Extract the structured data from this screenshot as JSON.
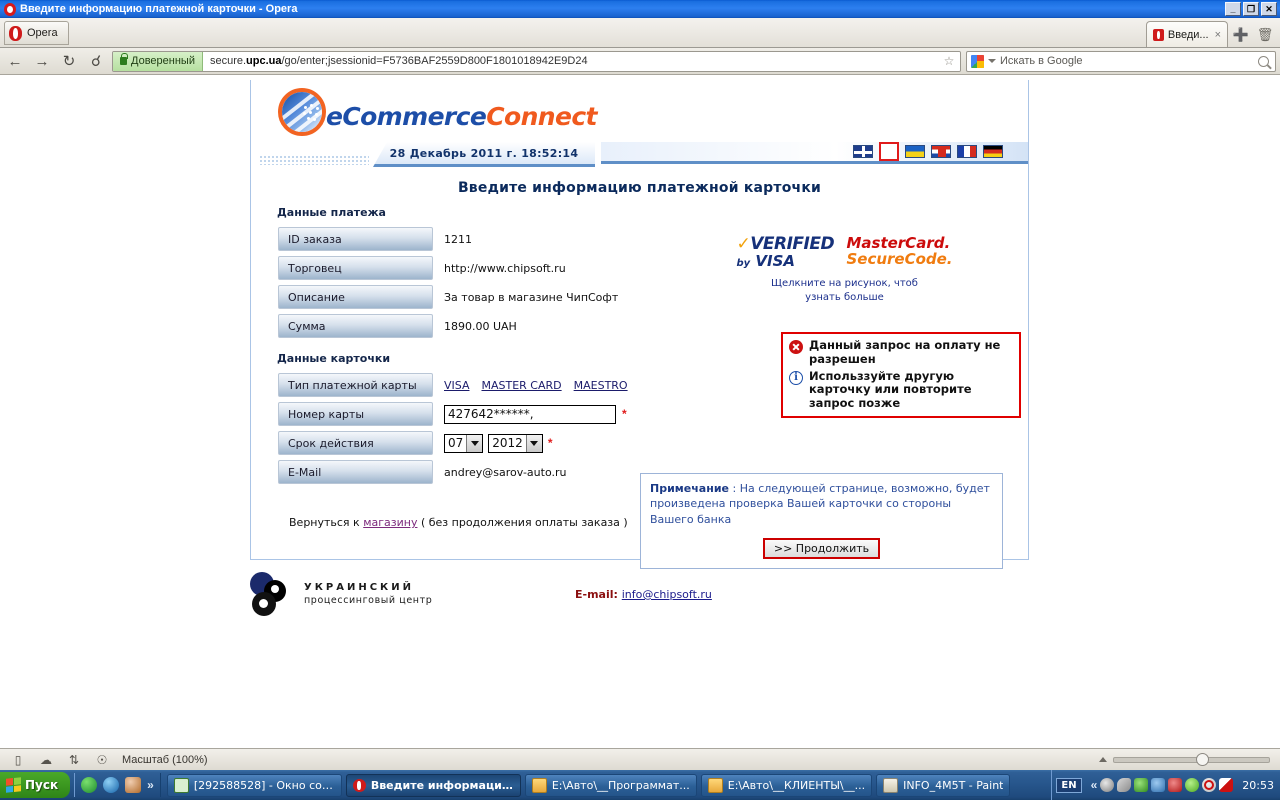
{
  "window": {
    "title": "Введите информацию платежной карточки - Opera",
    "icon": "opera-icon",
    "buttons": {
      "minimize": "_",
      "restore": "❐",
      "close": "✕"
    }
  },
  "browser": {
    "menu_button": "Opera",
    "tab": {
      "label": "Введи...",
      "close": "×"
    },
    "new_tab_icon": "plus-icon",
    "trash_icon": "trash-icon",
    "nav": {
      "back": "←",
      "forward": "→",
      "reload": "↻",
      "wand": "🔑"
    },
    "security_badge": "Доверенный",
    "url_prefix": "secure.",
    "url_host": "upc.ua",
    "url_rest": "/go/enter;jsessionid=F5736BAF2559D800F1801018942E9D24",
    "bookmark_icon": "star-icon",
    "search": {
      "engine": "google-icon",
      "placeholder": "Искать в Google"
    }
  },
  "site": {
    "logo": {
      "part1": "eCommerce",
      "part2": "Connect"
    },
    "datetime": "28 Декабрь 2011 г. 18:52:14",
    "languages": [
      {
        "name": "flag-uk",
        "selected": false
      },
      {
        "name": "flag-ru",
        "selected": true
      },
      {
        "name": "flag-ua",
        "selected": false
      },
      {
        "name": "flag-hr",
        "selected": false
      },
      {
        "name": "flag-fr",
        "selected": false
      },
      {
        "name": "flag-de",
        "selected": false
      }
    ],
    "page_title": "Введите информацию платежной карточки"
  },
  "payment_section": {
    "title": "Данные платежа",
    "rows": [
      {
        "label": "ID заказа",
        "value": "1211"
      },
      {
        "label": "Торговец",
        "value": "http://www.chipsoft.ru"
      },
      {
        "label": "Описание",
        "value": "За товар в магазине ЧипСофт"
      },
      {
        "label": "Сумма",
        "value": "1890.00 UAH"
      }
    ]
  },
  "card_section": {
    "title": "Данные карточки",
    "card_type_label": "Тип платежной карты",
    "card_types": [
      "VISA",
      "MASTER CARD",
      "MAESTRO"
    ],
    "number_label": "Номер карты",
    "number_value": "427642******,",
    "expiry_label": "Срок действия",
    "expiry_month": "07",
    "expiry_year": "2012",
    "email_label": "E-Mail",
    "email_value": "andrey@sarov-auto.ru",
    "required_mark": "*"
  },
  "back_line": {
    "prefix": "Вернуться к ",
    "link": "магазину",
    "suffix": " ( без продолжения оплаты заказа )"
  },
  "badges": {
    "verified_by_visa": {
      "line1": "VERIFIED",
      "line2_by": "by",
      "line2_visa": "VISA",
      "check": "✓"
    },
    "mastercard": {
      "line1": "MasterCard.",
      "line2": "SecureCode."
    },
    "note_line1": "Щелкните на рисунок, чтоб",
    "note_line2": "узнать больше"
  },
  "error_box": {
    "icon_error": "error-icon",
    "icon_info": "info-icon",
    "message1": "Данный запрос на оплату не разрешен",
    "message2": "Использзуйте другую карточку или повторите запрос позже",
    "border_color": "#e00000"
  },
  "note_box": {
    "label": "Примечание",
    "separator": " : ",
    "text": "На следующей странице, возможно, будет произведена проверка Вашей карточки со стороны Вашего банка",
    "button": ">> Продолжить"
  },
  "footer": {
    "upc_line1": "УКРАИНСКИЙ",
    "upc_line2": "процессинговый центр",
    "email_label": "E-mail:",
    "email_value": "info@chipsoft.ru"
  },
  "statusbar": {
    "icons": [
      "panel-icon",
      "cloud-icon",
      "transfer-icon",
      "shield-icon"
    ],
    "zoom_text": "Масштаб (100%)"
  },
  "taskbar": {
    "start": "Пуск",
    "quicklaunch_overflow": "»",
    "tasks": [
      {
        "icon": "message-icon",
        "label": "[292588528] - Окно соо...",
        "active": false
      },
      {
        "icon": "opera-icon",
        "label": "Введите информаци...",
        "active": true
      },
      {
        "icon": "folder-icon",
        "label": "E:\\Авто\\__Программат...",
        "active": false
      },
      {
        "icon": "folder-icon",
        "label": "E:\\Авто\\__КЛИЕНТЫ\\__...",
        "active": false
      },
      {
        "icon": "paint-icon",
        "label": "INFO_4M5T - Paint",
        "active": false
      }
    ],
    "language": "EN",
    "tray_overflow": "«",
    "clock": "20:53"
  }
}
